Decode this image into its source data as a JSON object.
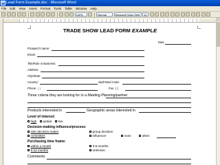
{
  "window": {
    "title": "Lead Form Example.doc - Microsoft Word"
  },
  "menu": {
    "items": [
      "File",
      "Edit",
      "View",
      "Insert",
      "Format",
      "Tools",
      "Table",
      "Window",
      "Help"
    ]
  },
  "toolbar": {
    "zoom": "100%",
    "style": "Normal",
    "font": "Microsoft Sans Serif",
    "size": "10"
  },
  "form": {
    "title_main": "TRADE SHOW LEAD FORM ",
    "title_italic": "EXAMPLE",
    "date_label": "Date",
    "prospect_label": "Prospect's name:",
    "email_label": "Email:",
    "title_role_label": "Title/Role in Business:",
    "address_label": "Address:",
    "citystate_label": "City/State:",
    "country_label": "Country:",
    "zip_label": "Zip/Postal Code:",
    "phone_label": "Phone:",
    "phone_paren": "(   )",
    "fax_label": "Fax:",
    "fax_paren": "(   )",
    "criteria_text": "Three criteria they are looking for in a ",
    "criteria_italic": "Meeting Planning/partner",
    "products_label": "Products interested in",
    "geographic_label": "Geographic areas interested in",
    "interest_heading": "Level of interest:",
    "interest_options": [
      "high",
      "partial",
      "low"
    ],
    "decision_heading": "Decision-making influence/process:",
    "decision_options": [
      "sole decision-maker",
      "group decision",
      "committee",
      "influencer",
      "none",
      "other:"
    ],
    "time_heading": "Purchasing time frame:",
    "time_options": [
      "within a month",
      "3-6 months",
      "9-12 months",
      "unknown"
    ],
    "comments_label": "Comments:"
  }
}
